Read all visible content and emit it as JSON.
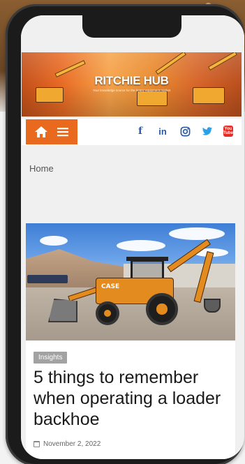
{
  "site": {
    "title": "RITCHIE HUB",
    "tagline": "Your knowledge source for the heavy equipment market"
  },
  "nav": {
    "home_icon": "home-icon",
    "menu_icon": "hamburger-menu-icon",
    "social": {
      "facebook": "f",
      "linkedin": "in",
      "instagram": "instagram-icon",
      "twitter": "twitter-icon",
      "youtube_top": "You",
      "youtube_bottom": "Tube"
    }
  },
  "breadcrumb": {
    "home": "Home"
  },
  "article": {
    "category": "Insights",
    "title": "5 things to remember when operating a loader backhoe",
    "date": "November 2, 2022",
    "image_logo": "CASE"
  },
  "colors": {
    "accent": "#e96a1f",
    "social_blue": "#2b5aa3",
    "twitter_blue": "#2aa1e6",
    "youtube_red": "#e52d27"
  }
}
